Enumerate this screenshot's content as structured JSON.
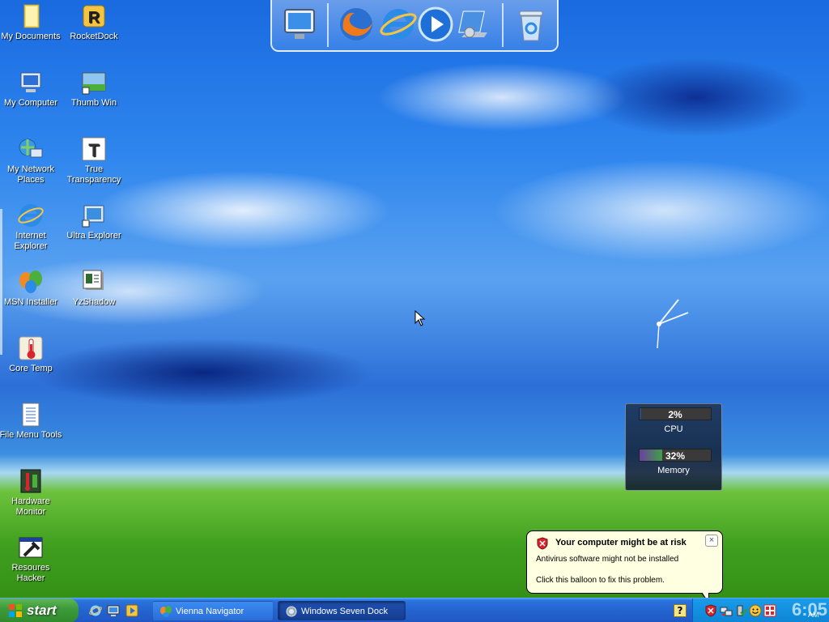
{
  "desktop": {
    "icons_left": [
      {
        "label": "My Documents"
      },
      {
        "label": "My Computer"
      },
      {
        "label": "My Network Places"
      },
      {
        "label": "Internet Explorer"
      },
      {
        "label": "MSN Installer"
      },
      {
        "label": "Core Temp"
      },
      {
        "label": "File Menu Tools"
      },
      {
        "label": "Hardware Monitor"
      },
      {
        "label": "Resoures Hacker"
      }
    ],
    "icons_right": [
      {
        "label": "RocketDock"
      },
      {
        "label": "Thumb Win"
      },
      {
        "label": "True Transparency"
      },
      {
        "label": "Ultra Explorer"
      },
      {
        "label": "YzShadow"
      }
    ]
  },
  "dock": {
    "items": [
      "monitor-icon",
      "firefox-icon",
      "internet-explorer-icon",
      "media-player-icon",
      "windows-tools-icon",
      "recycle-bin-icon"
    ]
  },
  "cpu_meter": {
    "cpu_value": "2%",
    "cpu_label": "CPU",
    "cpu_fraction": 0.02,
    "memory_value": "32%",
    "memory_label": "Memory",
    "memory_fraction": 0.32
  },
  "balloon": {
    "title": "Your computer might be at risk",
    "line1": "Antivirus software might not be installed",
    "line2": "Click this balloon to fix this problem.",
    "close": "×"
  },
  "taskbar": {
    "start_label": "start",
    "tasks": [
      {
        "label": "Vienna Navigator"
      },
      {
        "label": "Windows Seven Dock"
      }
    ],
    "help_glyph": "?",
    "clock_time": "6:05",
    "clock_ampm": "AM"
  },
  "colors": {
    "start_green": "#3e9b3b",
    "taskbar_blue": "#2564d0",
    "tray_blue": "#1290e0",
    "balloon_bg": "#ffffe1",
    "cpu_fill": "#1e4f8a",
    "memory_fill": "#6a3fa0"
  }
}
